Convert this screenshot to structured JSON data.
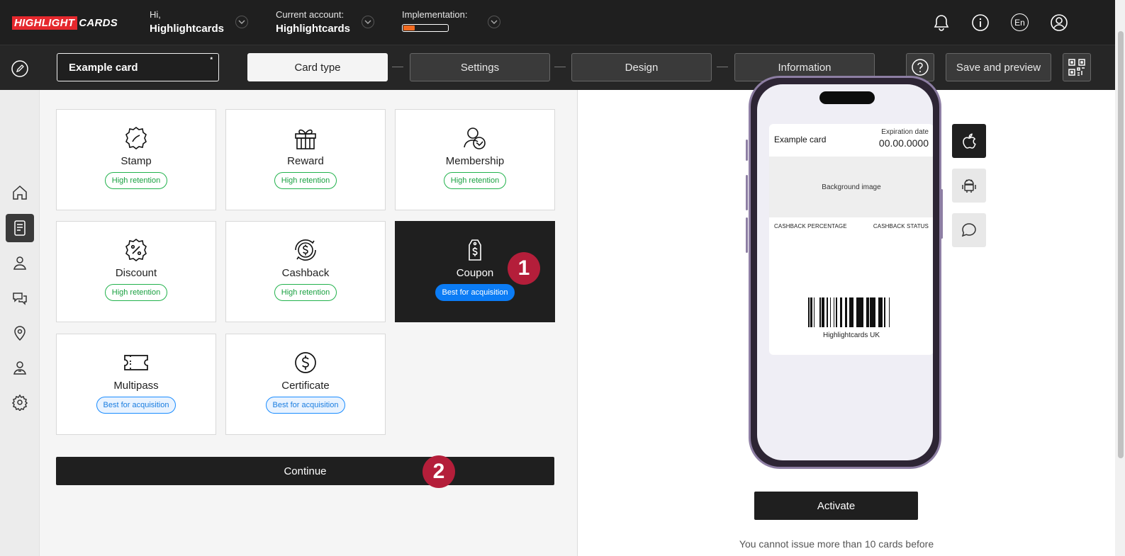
{
  "header": {
    "logo_part1": "HIGHLIGHT",
    "logo_part2": "CARDS",
    "greeting_label": "Hi,",
    "greeting_name": "Highlightcards",
    "account_label": "Current account:",
    "account_name": "Highlightcards",
    "implementation_label": "Implementation:",
    "implementation_progress": 0.25,
    "language": "En",
    "colors": {
      "bg": "#1f1f1f",
      "progress": "#f36b21",
      "logo_red": "#e5282d"
    }
  },
  "toolbar": {
    "card_name": "Example card",
    "required_mark": "*",
    "steps": [
      "Card type",
      "Settings",
      "Design",
      "Information"
    ],
    "active_step": 0,
    "save_label": "Save and preview"
  },
  "sidebar": {
    "items": [
      "home-icon",
      "cards-icon",
      "customers-icon",
      "chat-icon",
      "location-icon",
      "manager-icon",
      "gear-icon"
    ],
    "active_index": 1
  },
  "card_types": [
    {
      "name": "Stamp",
      "badge": "High retention",
      "badge_kind": "retention",
      "icon": "stamp-icon"
    },
    {
      "name": "Reward",
      "badge": "High retention",
      "badge_kind": "retention",
      "icon": "gift-icon"
    },
    {
      "name": "Membership",
      "badge": "High retention",
      "badge_kind": "retention",
      "icon": "membership-icon"
    },
    {
      "name": "Discount",
      "badge": "High retention",
      "badge_kind": "retention",
      "icon": "percent-badge-icon"
    },
    {
      "name": "Cashback",
      "badge": "High retention",
      "badge_kind": "retention",
      "icon": "cashback-icon"
    },
    {
      "name": "Coupon",
      "badge": "Best for acquisition",
      "badge_kind": "acquisition",
      "icon": "coupon-tag-icon",
      "selected": true
    },
    {
      "name": "Multipass",
      "badge": "Best for acquisition",
      "badge_kind": "acquisition",
      "icon": "ticket-icon"
    },
    {
      "name": "Certificate",
      "badge": "Best for acquisition",
      "badge_kind": "acquisition",
      "icon": "dollar-circle-icon"
    }
  ],
  "markers": [
    "1",
    "2"
  ],
  "continue_label": "Continue",
  "preview": {
    "card_title": "Example card",
    "expiration_label": "Expiration date",
    "expiration_value": "00.00.0000",
    "background_label": "Background image",
    "field_left": "CASHBACK PERCENTAGE",
    "field_right": "CASHBACK STATUS",
    "barcode_name": "Highlightcards UK",
    "os_buttons": [
      "apple-icon",
      "android-icon",
      "message-icon"
    ],
    "activate_label": "Activate",
    "note": "You cannot issue more than 10 cards before"
  }
}
